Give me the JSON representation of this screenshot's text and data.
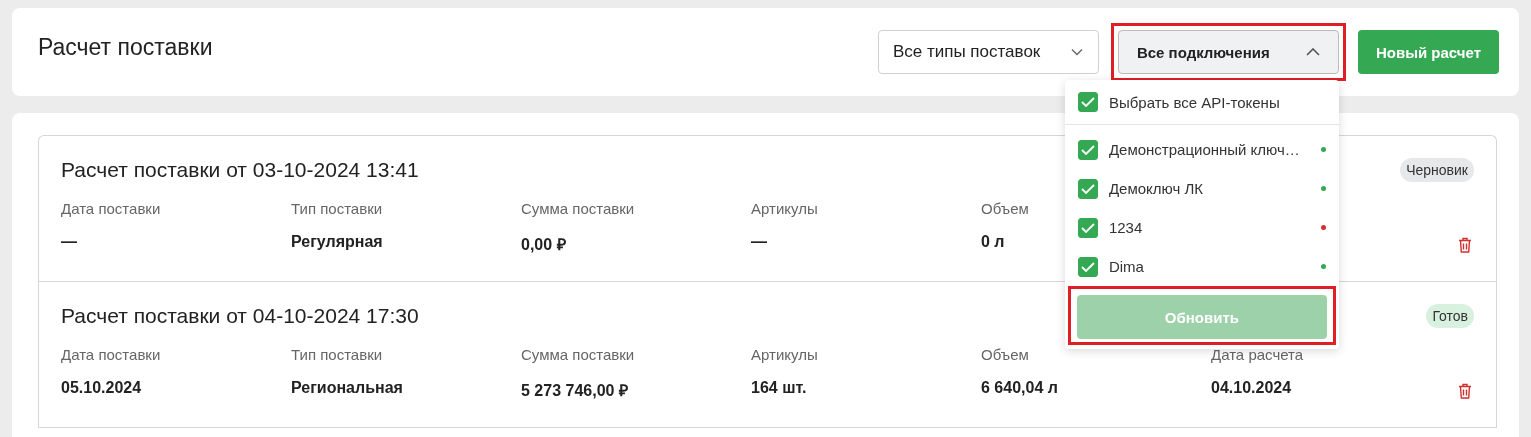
{
  "header": {
    "title": "Расчет поставки",
    "type_filter": {
      "value": "Все типы поставок",
      "expanded": false
    },
    "connections_filter": {
      "value": "Все подключения",
      "expanded": true,
      "highlighted": true
    },
    "new_button": "Новый расчет"
  },
  "connections_menu": {
    "select_all": {
      "label": "Выбрать все API-токены",
      "checked": true
    },
    "items": [
      {
        "label": "Демонстрационный ключ…",
        "checked": true,
        "color": "#34a853"
      },
      {
        "label": "Демоключ ЛК",
        "checked": true,
        "color": "#34a853"
      },
      {
        "label": "1234",
        "checked": true,
        "color": "#d32f2f"
      },
      {
        "label": "Dima",
        "checked": true,
        "color": "#34a853"
      }
    ],
    "update_button": {
      "label": "Обновить",
      "disabled": true,
      "highlighted": true
    }
  },
  "calculations": [
    {
      "title": "Расчет поставки от 03-10-2024 13:41",
      "status": "Черновик",
      "color": "#e7e8ea",
      "fields": [
        {
          "label": "Дата поставки",
          "value": "—"
        },
        {
          "label": "Тип поставки",
          "value": "Регулярная"
        },
        {
          "label": "Сумма поставки",
          "value": "0,00 ₽"
        },
        {
          "label": "Артикулы",
          "value": "—"
        },
        {
          "label": "Объем",
          "value": "0 л"
        }
      ]
    },
    {
      "title": "Расчет поставки от 04-10-2024 17:30",
      "status": "Готов",
      "color": "#d8f1df",
      "fields": [
        {
          "label": "Дата поставки",
          "value": "05.10.2024"
        },
        {
          "label": "Тип поставки",
          "value": "Региональная"
        },
        {
          "label": "Сумма поставки",
          "value": "5 273 746,00 ₽"
        },
        {
          "label": "Артикулы",
          "value": "164 шт."
        },
        {
          "label": "Объем",
          "value": "6 640,04 л"
        },
        {
          "label": "Дата расчета",
          "value": "04.10.2024"
        }
      ]
    }
  ]
}
